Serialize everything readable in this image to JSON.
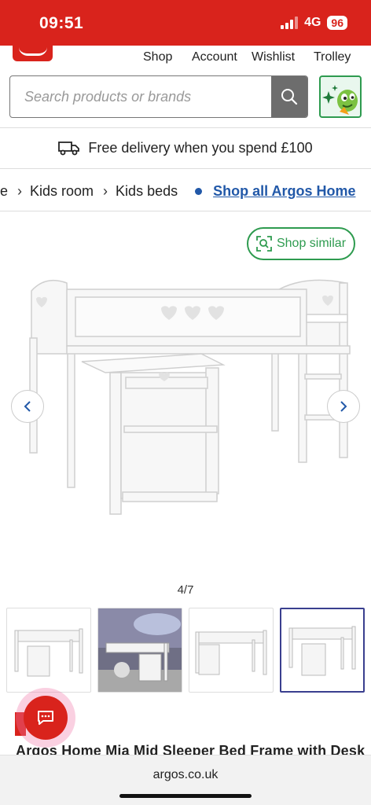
{
  "status_bar": {
    "time": "09:51",
    "network": "4G",
    "battery": "96"
  },
  "nav": {
    "shop": "Shop",
    "account": "Account",
    "wishlist": "Wishlist",
    "trolley": "Trolley"
  },
  "search": {
    "placeholder": "Search products or brands"
  },
  "delivery": {
    "text": "Free delivery when you spend £100"
  },
  "breadcrumb": {
    "partial": "re",
    "items": [
      "Kids room",
      "Kids beds"
    ],
    "shop_all": "Shop all Argos Home"
  },
  "shop_similar": {
    "label": "Shop similar"
  },
  "gallery": {
    "counter": "4/7",
    "active_index": 4
  },
  "product": {
    "title": "Argos Home Mia Mid Sleeper Bed Frame with Desk"
  },
  "browser": {
    "url": "argos.co.uk"
  },
  "colors": {
    "brand_red": "#d9231c",
    "link_blue": "#2158a8",
    "green": "#2e9b4f",
    "active_thumb": "#3a3f8f"
  }
}
